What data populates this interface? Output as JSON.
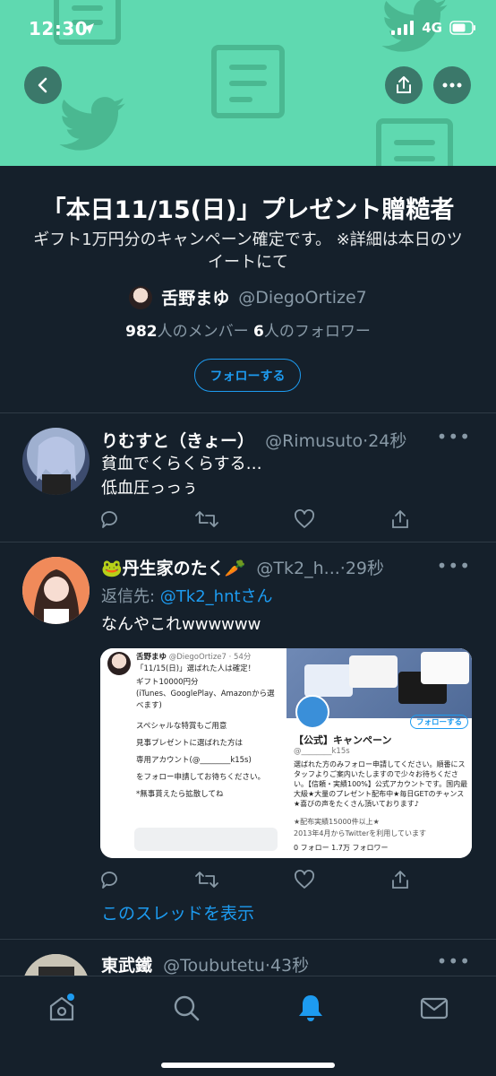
{
  "status_bar": {
    "time": "12:30",
    "network": "4G"
  },
  "list": {
    "title": "「本日11/15(日)」プレゼント贈糙者",
    "description": "ギフト1万円分のキャンペーン確定です。 ※詳細は本日のツイートにて",
    "owner_name": "舌野まゆ",
    "owner_handle": "@DiegoOrtize7",
    "member_count": "982",
    "member_label": "人のメンバー",
    "follower_count": "6",
    "follower_label": "人のフォロワー",
    "follow_button": "フォローする"
  },
  "tweets": [
    {
      "name": "りむすと（きょー）",
      "handle": "@Rimusuto",
      "time": "24秒",
      "lines": [
        "貧血でくらくらする…",
        "低血圧っっぅ"
      ]
    },
    {
      "name": "🐸丹生家のたく🥕",
      "handle": "@Tk2_h...",
      "time": "29秒",
      "reply_prefix": "返信先: ",
      "reply_to": "@Tk2_hntさん",
      "text": "なんやこれwwwwww",
      "media_left": {
        "name": "舌野まゆ",
        "handle": "@DiegoOrtize7 · 54分",
        "lines": [
          "「11/15(日)」選ばれた人は確定！",
          "",
          "ギフト10000円分",
          "(iTunes、GooglePlay、Amazonから選べます)",
          "",
          "スペシャルな特賞もご用意",
          "",
          "見事プレゼントに選ばれた方は",
          "",
          "専用アカウント(@________k15s)",
          "",
          "をフォロー申請してお待ちください。",
          "",
          "*無事貰えたら拡散してね"
        ]
      },
      "media_right": {
        "follow_label": "フォローする",
        "title": "【公式】キャンペーン",
        "handle": "@________k15s",
        "bio": "選ばれた方のみフォロー申請してください。順番にスタッフよりご案内いたしますので少々お待ちください。【信頼・実績100%】公式アカウントです。国内最大級★大量のプレゼント配布中★毎日GETのチャンス★喜びの声をたくさん頂いております♪",
        "meta1": "★配布実績15000件以上★",
        "meta2": "2013年4月からTwitterを利用しています",
        "stats": "0 フォロー  1.7万 フォロワー"
      },
      "thread_link": "このスレッドを表示"
    },
    {
      "name": "東武鐵",
      "handle": "@Toubutetu",
      "time": "43秒"
    }
  ],
  "colors": {
    "accent": "#1d9bf0",
    "background": "#15202b",
    "banner": "#5fd9b0"
  },
  "icons": [
    "back-icon",
    "share-icon",
    "more-icon",
    "reply-icon",
    "retweet-icon",
    "like-icon",
    "home-icon",
    "search-icon",
    "notifications-icon",
    "messages-icon"
  ]
}
